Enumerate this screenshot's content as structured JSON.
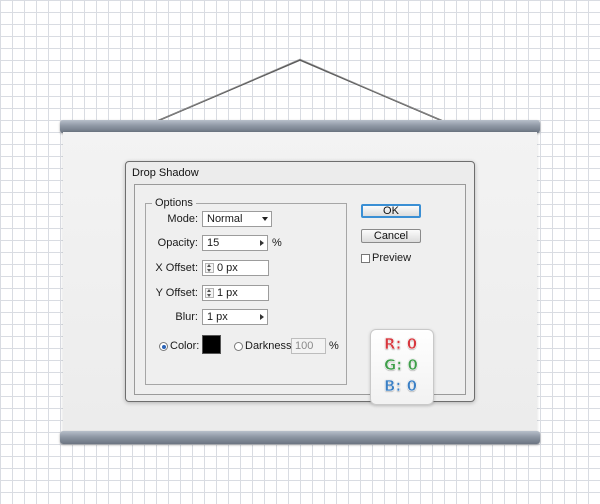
{
  "dialog": {
    "title": "Drop Shadow",
    "options_legend": "Options",
    "mode": {
      "label": "Mode:",
      "value": "Normal"
    },
    "opacity": {
      "label": "Opacity:",
      "value": "15",
      "unit": "%"
    },
    "x_offset": {
      "label": "X Offset:",
      "value": "0 px"
    },
    "y_offset": {
      "label": "Y Offset:",
      "value": "1 px"
    },
    "blur": {
      "label": "Blur:",
      "value": "1 px"
    },
    "color": {
      "label": "Color:",
      "selected": true,
      "swatch": "#000000"
    },
    "darkness": {
      "label": "Darkness:",
      "value": "100",
      "unit": "%",
      "selected": false
    },
    "buttons": {
      "ok": "OK",
      "cancel": "Cancel"
    },
    "preview": {
      "label": "Preview",
      "checked": false
    }
  },
  "rgb": {
    "r": {
      "text": "R: 0",
      "color": "#d7383f"
    },
    "g": {
      "text": "G: 0",
      "color": "#3f9e4a"
    },
    "b": {
      "text": "B: 0",
      "color": "#3b7fc4"
    }
  },
  "colors": {
    "rod": "#8e97a4",
    "ok_border": "#3a8fd4",
    "grid_line": "#d9dce2"
  }
}
